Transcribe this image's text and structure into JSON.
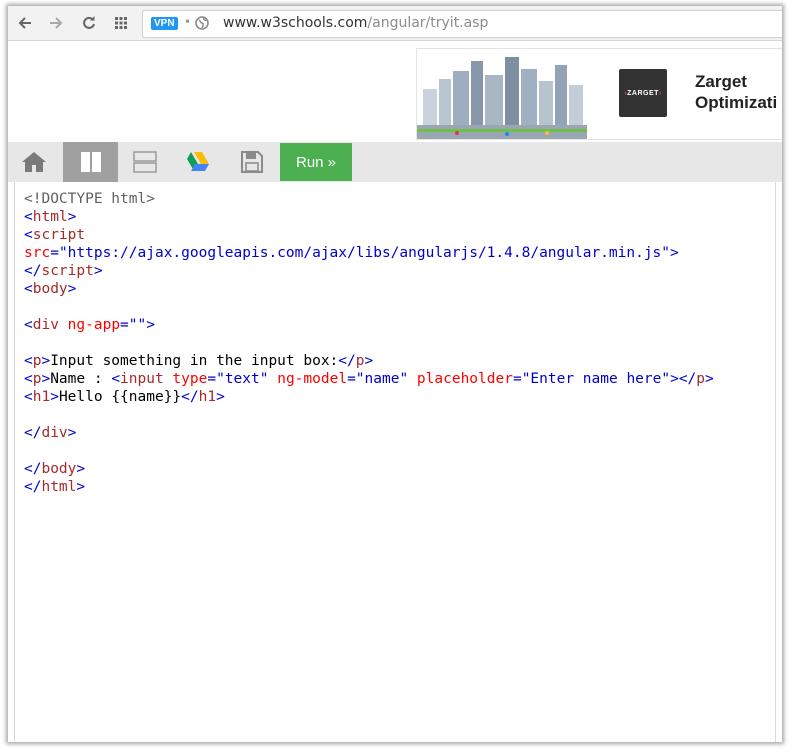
{
  "browser": {
    "vpn_label": "VPN",
    "url_host": "www.w3schools.com",
    "url_path": "/angular/tryit.asp"
  },
  "ad": {
    "logo_text": "ZARGET",
    "title_line1": "Zarget",
    "title_line2": "Optimizati"
  },
  "toolbar": {
    "run_label": "Run »",
    "icons": [
      "home-icon",
      "two-columns-icon",
      "two-rows-icon",
      "google-drive-icon",
      "save-icon"
    ],
    "colors": {
      "run_bg": "#4caf50",
      "active_bg": "#a0a0a0",
      "toolbar_bg": "#e7e7e7"
    }
  },
  "code": {
    "lines": [
      [
        {
          "c": "d",
          "t": "<!DOCTYPE html>"
        }
      ],
      [
        {
          "c": "b",
          "t": "<"
        },
        {
          "c": "t",
          "t": "html"
        },
        {
          "c": "b",
          "t": ">"
        }
      ],
      [
        {
          "c": "b",
          "t": "<"
        },
        {
          "c": "t",
          "t": "script"
        }
      ],
      [
        {
          "c": "a",
          "t": "src"
        },
        {
          "c": "b",
          "t": "="
        },
        {
          "c": "v",
          "t": "\"https://ajax.googleapis.com/ajax/libs/angularjs/1.4.8/angular.min.js\""
        },
        {
          "c": "b",
          "t": ">"
        }
      ],
      [
        {
          "c": "b",
          "t": "</"
        },
        {
          "c": "t",
          "t": "script"
        },
        {
          "c": "b",
          "t": ">"
        }
      ],
      [
        {
          "c": "b",
          "t": "<"
        },
        {
          "c": "t",
          "t": "body"
        },
        {
          "c": "b",
          "t": ">"
        }
      ],
      [],
      [
        {
          "c": "b",
          "t": "<"
        },
        {
          "c": "t",
          "t": "div"
        },
        {
          "c": "a",
          "t": " ng-app"
        },
        {
          "c": "b",
          "t": "="
        },
        {
          "c": "v",
          "t": "\"\""
        },
        {
          "c": "b",
          "t": ">"
        }
      ],
      [],
      [
        {
          "c": "b",
          "t": "<"
        },
        {
          "c": "t",
          "t": "p"
        },
        {
          "c": "b",
          "t": ">"
        },
        {
          "c": "",
          "t": "Input something in the input box:"
        },
        {
          "c": "b",
          "t": "</"
        },
        {
          "c": "t",
          "t": "p"
        },
        {
          "c": "b",
          "t": ">"
        }
      ],
      [
        {
          "c": "b",
          "t": "<"
        },
        {
          "c": "t",
          "t": "p"
        },
        {
          "c": "b",
          "t": ">"
        },
        {
          "c": "",
          "t": "Name : "
        },
        {
          "c": "b",
          "t": "<"
        },
        {
          "c": "t",
          "t": "input"
        },
        {
          "c": "a",
          "t": " type"
        },
        {
          "c": "b",
          "t": "="
        },
        {
          "c": "v",
          "t": "\"text\""
        },
        {
          "c": "a",
          "t": " ng-model"
        },
        {
          "c": "b",
          "t": "="
        },
        {
          "c": "v",
          "t": "\"name\""
        },
        {
          "c": "a",
          "t": " placeholder"
        },
        {
          "c": "b",
          "t": "="
        },
        {
          "c": "v",
          "t": "\"Enter name here\""
        },
        {
          "c": "b",
          "t": "></"
        },
        {
          "c": "t",
          "t": "p"
        },
        {
          "c": "b",
          "t": ">"
        }
      ],
      [
        {
          "c": "b",
          "t": "<"
        },
        {
          "c": "t",
          "t": "h1"
        },
        {
          "c": "b",
          "t": ">"
        },
        {
          "c": "",
          "t": "Hello {{name}}"
        },
        {
          "c": "b",
          "t": "</"
        },
        {
          "c": "t",
          "t": "h1"
        },
        {
          "c": "b",
          "t": ">"
        }
      ],
      [],
      [
        {
          "c": "b",
          "t": "</"
        },
        {
          "c": "t",
          "t": "div"
        },
        {
          "c": "b",
          "t": ">"
        }
      ],
      [],
      [
        {
          "c": "b",
          "t": "</"
        },
        {
          "c": "t",
          "t": "body"
        },
        {
          "c": "b",
          "t": ">"
        }
      ],
      [
        {
          "c": "b",
          "t": "</"
        },
        {
          "c": "t",
          "t": "html"
        },
        {
          "c": "b",
          "t": ">"
        }
      ]
    ]
  }
}
